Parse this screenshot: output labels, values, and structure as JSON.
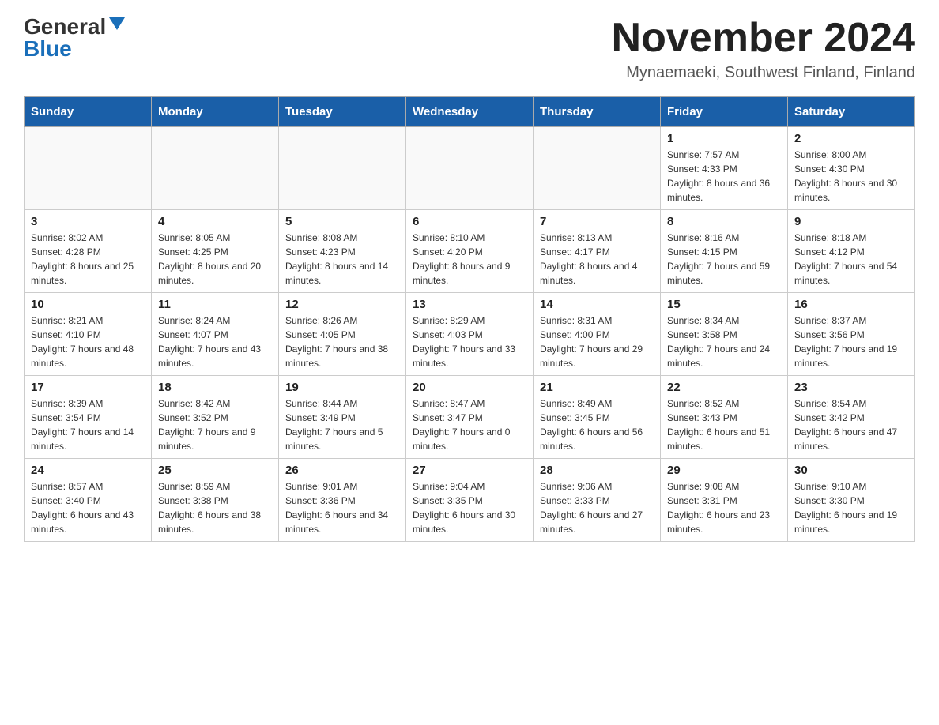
{
  "logo": {
    "general": "General",
    "blue": "Blue"
  },
  "title": "November 2024",
  "subtitle": "Mynaemaeki, Southwest Finland, Finland",
  "days_of_week": [
    "Sunday",
    "Monday",
    "Tuesday",
    "Wednesday",
    "Thursday",
    "Friday",
    "Saturday"
  ],
  "weeks": [
    [
      {
        "day": "",
        "info": ""
      },
      {
        "day": "",
        "info": ""
      },
      {
        "day": "",
        "info": ""
      },
      {
        "day": "",
        "info": ""
      },
      {
        "day": "",
        "info": ""
      },
      {
        "day": "1",
        "info": "Sunrise: 7:57 AM\nSunset: 4:33 PM\nDaylight: 8 hours and 36 minutes."
      },
      {
        "day": "2",
        "info": "Sunrise: 8:00 AM\nSunset: 4:30 PM\nDaylight: 8 hours and 30 minutes."
      }
    ],
    [
      {
        "day": "3",
        "info": "Sunrise: 8:02 AM\nSunset: 4:28 PM\nDaylight: 8 hours and 25 minutes."
      },
      {
        "day": "4",
        "info": "Sunrise: 8:05 AM\nSunset: 4:25 PM\nDaylight: 8 hours and 20 minutes."
      },
      {
        "day": "5",
        "info": "Sunrise: 8:08 AM\nSunset: 4:23 PM\nDaylight: 8 hours and 14 minutes."
      },
      {
        "day": "6",
        "info": "Sunrise: 8:10 AM\nSunset: 4:20 PM\nDaylight: 8 hours and 9 minutes."
      },
      {
        "day": "7",
        "info": "Sunrise: 8:13 AM\nSunset: 4:17 PM\nDaylight: 8 hours and 4 minutes."
      },
      {
        "day": "8",
        "info": "Sunrise: 8:16 AM\nSunset: 4:15 PM\nDaylight: 7 hours and 59 minutes."
      },
      {
        "day": "9",
        "info": "Sunrise: 8:18 AM\nSunset: 4:12 PM\nDaylight: 7 hours and 54 minutes."
      }
    ],
    [
      {
        "day": "10",
        "info": "Sunrise: 8:21 AM\nSunset: 4:10 PM\nDaylight: 7 hours and 48 minutes."
      },
      {
        "day": "11",
        "info": "Sunrise: 8:24 AM\nSunset: 4:07 PM\nDaylight: 7 hours and 43 minutes."
      },
      {
        "day": "12",
        "info": "Sunrise: 8:26 AM\nSunset: 4:05 PM\nDaylight: 7 hours and 38 minutes."
      },
      {
        "day": "13",
        "info": "Sunrise: 8:29 AM\nSunset: 4:03 PM\nDaylight: 7 hours and 33 minutes."
      },
      {
        "day": "14",
        "info": "Sunrise: 8:31 AM\nSunset: 4:00 PM\nDaylight: 7 hours and 29 minutes."
      },
      {
        "day": "15",
        "info": "Sunrise: 8:34 AM\nSunset: 3:58 PM\nDaylight: 7 hours and 24 minutes."
      },
      {
        "day": "16",
        "info": "Sunrise: 8:37 AM\nSunset: 3:56 PM\nDaylight: 7 hours and 19 minutes."
      }
    ],
    [
      {
        "day": "17",
        "info": "Sunrise: 8:39 AM\nSunset: 3:54 PM\nDaylight: 7 hours and 14 minutes."
      },
      {
        "day": "18",
        "info": "Sunrise: 8:42 AM\nSunset: 3:52 PM\nDaylight: 7 hours and 9 minutes."
      },
      {
        "day": "19",
        "info": "Sunrise: 8:44 AM\nSunset: 3:49 PM\nDaylight: 7 hours and 5 minutes."
      },
      {
        "day": "20",
        "info": "Sunrise: 8:47 AM\nSunset: 3:47 PM\nDaylight: 7 hours and 0 minutes."
      },
      {
        "day": "21",
        "info": "Sunrise: 8:49 AM\nSunset: 3:45 PM\nDaylight: 6 hours and 56 minutes."
      },
      {
        "day": "22",
        "info": "Sunrise: 8:52 AM\nSunset: 3:43 PM\nDaylight: 6 hours and 51 minutes."
      },
      {
        "day": "23",
        "info": "Sunrise: 8:54 AM\nSunset: 3:42 PM\nDaylight: 6 hours and 47 minutes."
      }
    ],
    [
      {
        "day": "24",
        "info": "Sunrise: 8:57 AM\nSunset: 3:40 PM\nDaylight: 6 hours and 43 minutes."
      },
      {
        "day": "25",
        "info": "Sunrise: 8:59 AM\nSunset: 3:38 PM\nDaylight: 6 hours and 38 minutes."
      },
      {
        "day": "26",
        "info": "Sunrise: 9:01 AM\nSunset: 3:36 PM\nDaylight: 6 hours and 34 minutes."
      },
      {
        "day": "27",
        "info": "Sunrise: 9:04 AM\nSunset: 3:35 PM\nDaylight: 6 hours and 30 minutes."
      },
      {
        "day": "28",
        "info": "Sunrise: 9:06 AM\nSunset: 3:33 PM\nDaylight: 6 hours and 27 minutes."
      },
      {
        "day": "29",
        "info": "Sunrise: 9:08 AM\nSunset: 3:31 PM\nDaylight: 6 hours and 23 minutes."
      },
      {
        "day": "30",
        "info": "Sunrise: 9:10 AM\nSunset: 3:30 PM\nDaylight: 6 hours and 19 minutes."
      }
    ]
  ]
}
